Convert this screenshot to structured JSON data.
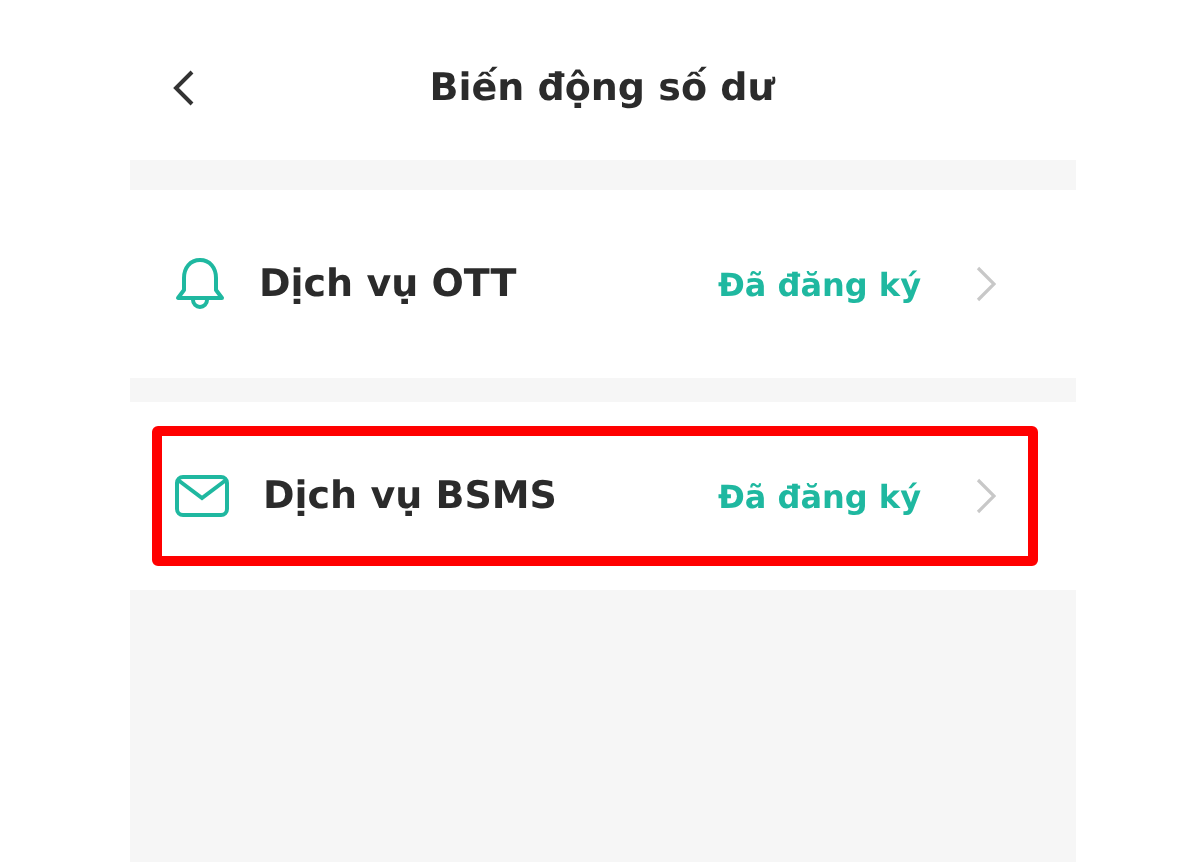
{
  "header": {
    "title": "Biến động số dư"
  },
  "services": [
    {
      "kind": "bell",
      "label": "Dịch vụ OTT",
      "status": "Đã đăng ký",
      "highlighted": false
    },
    {
      "kind": "mail",
      "label": "Dịch vụ BSMS",
      "status": "Đã đăng ký",
      "highlighted": true
    }
  ]
}
